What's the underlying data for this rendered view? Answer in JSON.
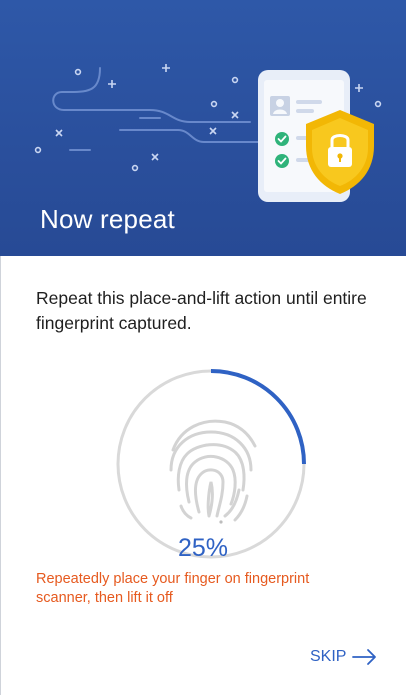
{
  "header": {
    "title": "Now repeat"
  },
  "main": {
    "instruction": "Repeat this place-and-lift action until entire fingerprint captured.",
    "progress": {
      "value": 0.25,
      "label": "25%"
    },
    "hint": "Repeatedly place your finger on fingerprint scanner, then lift it off",
    "skip_label": "SKIP"
  },
  "colors": {
    "header_bg": "#2a4f9c",
    "accent": "#2f62c4",
    "hint": "#e65a1f",
    "ring_track": "#d9d9d9"
  },
  "icons": [
    "shield-lock-icon",
    "phone-illustration",
    "fingerprint-icon",
    "arrow-right-icon"
  ]
}
